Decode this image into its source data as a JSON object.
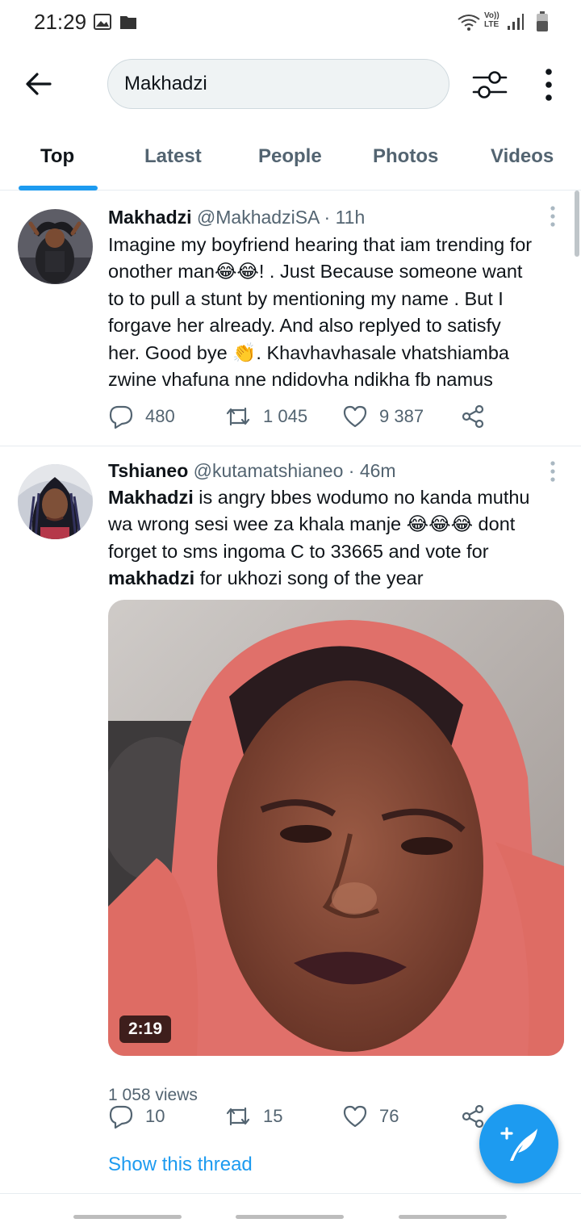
{
  "status_bar": {
    "time": "21:29",
    "icons": [
      "gallery-icon",
      "folder-icon",
      "wifi-icon",
      "volte-lte-icon",
      "signal-icon",
      "battery-icon"
    ],
    "network_top": "Vo))",
    "network_bottom": "LTE"
  },
  "search": {
    "query": "Makhadzi"
  },
  "tabs": [
    {
      "label": "Top",
      "active": true
    },
    {
      "label": "Latest",
      "active": false
    },
    {
      "label": "People",
      "active": false
    },
    {
      "label": "Photos",
      "active": false
    },
    {
      "label": "Videos",
      "active": false
    }
  ],
  "tweets": [
    {
      "name": "Makhadzi",
      "handle": "@MakhadziSA",
      "time": "· 11h",
      "text_lines": [
        "Imagine my boyfriend hearing that iam trending for",
        "onother man😂😂! . Just Because someone want",
        "to to pull a stunt by mentioning my name . But I",
        "forgave her already. And also replyed to satisfy",
        "her. Good bye 👏. Khavhavhasale vhatshiamba",
        "zwine vhafuna nne ndidovha ndikha fb namus"
      ],
      "replies": "480",
      "retweets": "1 045",
      "likes": "9 387"
    },
    {
      "name": "Tshianeo",
      "handle": "@kutamatshianeo",
      "time": "· 46m",
      "text_lines": [
        {
          "bold": "Makhadzi",
          "rest": " is angry bbes wodumo no kanda muthu"
        },
        {
          "bold": "",
          "rest": "wa wrong sesi wee za khala manje 😂😂😂 dont"
        },
        {
          "bold": "",
          "rest": "forget to sms ingoma C to 33665 and vote for"
        },
        {
          "bold": "makhadzi",
          "rest": " for ukhozi song of the year"
        }
      ],
      "video_duration": "2:19",
      "views": "1 058 views",
      "replies": "10",
      "retweets": "15",
      "likes": "76",
      "thread_link": "Show this thread"
    }
  ],
  "colors": {
    "accent": "#1d9bf0",
    "text_primary": "#0f1419",
    "text_secondary": "#536471",
    "divider": "#e6ecf0"
  }
}
